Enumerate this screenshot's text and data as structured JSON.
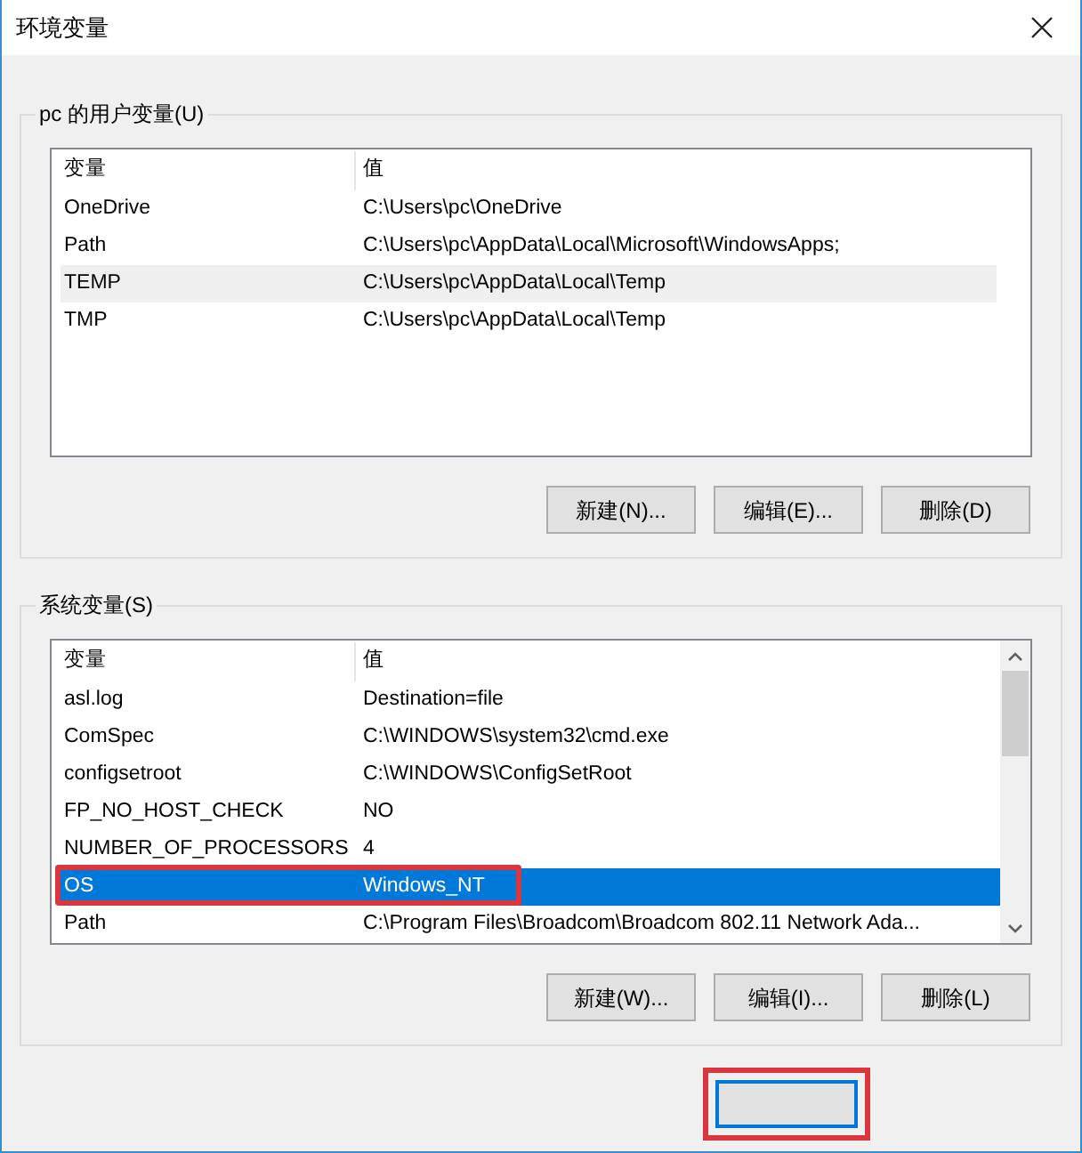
{
  "window": {
    "title": "环境变量"
  },
  "user_vars": {
    "label": "pc 的用户变量(U)",
    "focused": false,
    "columns": [
      "变量",
      "值"
    ],
    "rows": [
      {
        "name": "OneDrive",
        "value": "C:\\Users\\pc\\OneDrive",
        "selected": false
      },
      {
        "name": "Path",
        "value": "C:\\Users\\pc\\AppData\\Local\\Microsoft\\WindowsApps;",
        "selected": false
      },
      {
        "name": "TEMP",
        "value": "C:\\Users\\pc\\AppData\\Local\\Temp",
        "selected": true
      },
      {
        "name": "TMP",
        "value": "C:\\Users\\pc\\AppData\\Local\\Temp",
        "selected": false
      }
    ],
    "buttons": [
      "新建(N)...",
      "编辑(E)...",
      "删除(D)"
    ]
  },
  "system_vars": {
    "label": "系统变量(S)",
    "focused": true,
    "columns": [
      "变量",
      "值"
    ],
    "rows": [
      {
        "name": "asl.log",
        "value": "Destination=file",
        "selected": false,
        "highlighted": false
      },
      {
        "name": "ComSpec",
        "value": "C:\\WINDOWS\\system32\\cmd.exe",
        "selected": false,
        "highlighted": false
      },
      {
        "name": "configsetroot",
        "value": "C:\\WINDOWS\\ConfigSetRoot",
        "selected": false,
        "highlighted": false
      },
      {
        "name": "FP_NO_HOST_CHECK",
        "value": "NO",
        "selected": false,
        "highlighted": false
      },
      {
        "name": "NUMBER_OF_PROCESSORS",
        "value": "4",
        "selected": false,
        "highlighted": false
      },
      {
        "name": "OS",
        "value": "Windows_NT",
        "selected": true,
        "highlighted": true
      },
      {
        "name": "Path",
        "value": "C:\\Program Files\\Broadcom\\Broadcom 802.11 Network Ada...",
        "selected": false,
        "highlighted": false
      }
    ],
    "buttons": [
      "新建(W)...",
      "编辑(I)...",
      "删除(L)"
    ]
  },
  "ok_button": {
    "default": true,
    "highlighted": true
  }
}
